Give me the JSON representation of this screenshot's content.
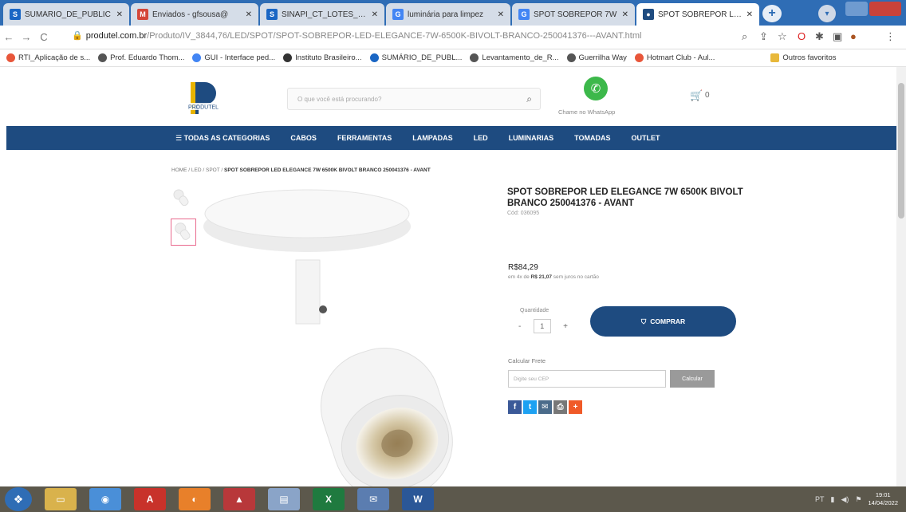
{
  "browser": {
    "tabs": [
      {
        "label": "SUMÁRIO_DE_PUBLIC",
        "fav": "S",
        "color": "#1a66c4"
      },
      {
        "label": "Enviados - gfsousa@",
        "fav": "M",
        "color": "#d44638"
      },
      {
        "label": "SINAPI_CT_LOTES_FOR",
        "fav": "S",
        "color": "#1a66c4"
      },
      {
        "label": "luminária para limpez",
        "fav": "G",
        "color": "#4285f4"
      },
      {
        "label": "SPOT SOBREPOR 7W",
        "fav": "G",
        "color": "#4285f4"
      },
      {
        "label": "SPOT SOBREPOR LED",
        "fav": "●",
        "color": "#1e4b80"
      }
    ],
    "url_domain": "produtel.com.br",
    "url_path": "/Produto/IV_3844,76/LED/SPOT/SPOT-SOBREPOR-LED-ELEGANCE-7W-6500K-BIVOLT-BRANCO-250041376---AVANT.html",
    "bookmarks": [
      {
        "label": "RTI_Aplicação de s...",
        "color": "#e8563a"
      },
      {
        "label": "Prof. Eduardo Thom...",
        "color": "#555"
      },
      {
        "label": "GUI - Interface ped...",
        "color": "#4285f4"
      },
      {
        "label": "Instituto Brasileiro...",
        "color": "#333"
      },
      {
        "label": "SUMÁRIO_DE_PUBL...",
        "color": "#1a66c4"
      },
      {
        "label": "Levantamento_de_R...",
        "color": "#555"
      },
      {
        "label": "Guerrilha Way",
        "color": "#555"
      },
      {
        "label": "Hotmart Club - Aul...",
        "color": "#e8563a"
      },
      {
        "label": "Outros favoritos",
        "color": "#e8b83a"
      }
    ]
  },
  "header": {
    "logo_text": "PRODUTEL",
    "search_placeholder": "O que você está procurando?",
    "whatsapp_label": "Chame no WhatsApp",
    "cart_count": "0"
  },
  "menu": [
    "☰  TODAS AS CATEGORIAS",
    "CABOS",
    "FERRAMENTAS",
    "LAMPADAS",
    "LED",
    "LUMINARIAS",
    "TOMADAS",
    "OUTLET"
  ],
  "breadcrumb": {
    "path": "HOME / LED / SPOT /",
    "current": "SPOT SOBREPOR LED ELEGANCE 7W 6500K BIVOLT BRANCO 250041376 - AVANT"
  },
  "product": {
    "title": "SPOT SOBREPOR LED ELEGANCE 7W 6500K BIVOLT BRANCO 250041376 - AVANT",
    "code": "Cód: 036095",
    "price": "R$84,29",
    "installments_prefix": "em 4x de",
    "installments_value": "R$ 21,07",
    "installments_suffix": "sem juros no cartão",
    "quantity_label": "Quantidade",
    "quantity": "1",
    "buy_label": "COMPRAR",
    "shipping_label": "Calcular Frete",
    "shipping_placeholder": "Digite seu CEP",
    "shipping_button": "Calcular"
  },
  "taskbar": {
    "time": "19:01",
    "date": "14/04/2022"
  }
}
